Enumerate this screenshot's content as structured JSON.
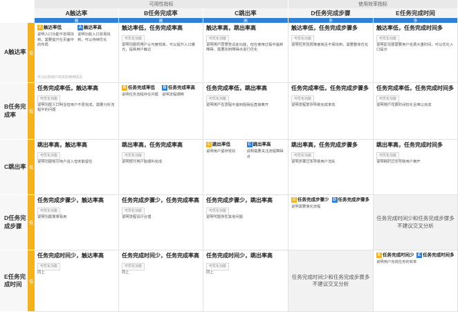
{
  "groups": {
    "usability": "可用性指标",
    "efficiency": "使用效率指标"
  },
  "priority": {
    "high": "高",
    "many": "多",
    "row_low": "低"
  },
  "columns": [
    "A触达率",
    "B任务完成率",
    "C跳出率",
    "D任务完成步骤",
    "E任务完成时间"
  ],
  "rows": [
    "A触达率",
    "B任务完成率",
    "C跳出率",
    "D任务完成步骤",
    "E任务完成时间"
  ],
  "badge_option": "可优化功能",
  "cells": {
    "aa_title1": "触达率低",
    "aa_desc1": "说明入口功能不容易找到，需要提升在页面中的布局",
    "aa_title2": "触达率高",
    "aa_desc2": "说明功能入口容易找到，可以持续优化",
    "aa_note": "可以比较用户的实际使用情况",
    "ab_title": "触达率低，任务完成率高",
    "ab_desc": "说明功能的用户认可度较高，可以提升入口曝光，提高用户触达",
    "ac_title": "触达率高，跳出率高",
    "ac_desc": "说明用户愿意尝试此功能，但在使用过程中遇到障碍，需要找到障碍点进行优化",
    "ad_title": "触达率低，任务完成步骤多",
    "ad_desc": "说明任务完成难度高且不易找到，需要整体优化",
    "ae_title": "触达率低，任务完成时间多",
    "ae_desc": "说明此功能需要用户花费大量时间，可以优化入口提示"
  },
  "row_b": {
    "ba_title": "任务完成率低，触达率高",
    "ba_desc": "说明功能入口明显但用户不愿完成，需要分析流程中的问题",
    "bb_title1": "任务完成率低",
    "bb_desc1": "说明任务流程存在问题",
    "bb_title2": "任务完成率高",
    "bb_desc2": "说明流程顺畅",
    "bc_title": "任务完成率低，跳出率高",
    "bc_desc": "说明用户在流程中遇到阻碍后直接离开",
    "bd_title": "任务完成率低，任务完成步骤多",
    "bd_desc": "说明流程复杂导致完成率低",
    "be_title": "任务完成率低，任务完成时间多",
    "be_desc": "说明用户花费时间较长且难以完成"
  },
  "row_c": {
    "ca_title": "跳出率高，触达率高",
    "ca_desc": "说明功能吸引用户进入但未能留住",
    "cb_title": "跳出率高，任务完成率高",
    "cb_desc": "说明部分用户能顺利完成",
    "cc_title1": "跳出率低",
    "cc_desc1": "说明用户留存较好",
    "cc_title2": "跳出率高",
    "cc_desc2": "说明需要关注流程障碍点",
    "cd_title": "跳出率高，任务完成步骤多",
    "cd_desc": "说明步骤过多导致用户流失",
    "ce_title": "跳出率高，任务完成时间多",
    "ce_desc": "说明耗时过长导致用户离开"
  },
  "row_d": {
    "da_title": "任务完成步骤少，触达率高",
    "da_desc": "说明功能简单易用",
    "db_title": "任务完成步骤少，任务完成率高",
    "db_desc": "说明流程设计合理",
    "dc_title": "任务完成步骤少，跳出率高",
    "dc_desc": "说明可能存在其他问题",
    "dd_title1": "任务完成步骤少",
    "dd_title2": "任务完成步骤多",
    "dd_desc": "说明需要简化流程",
    "de_text": "任务完成时间少和任务完成步骤多不建议交叉分析"
  },
  "row_e": {
    "ea_title": "任务完成时间少，触达率高",
    "ea_desc": "同上",
    "eb_title": "任务完成时间少，任务完成率高",
    "eb_desc": "同上",
    "ec_title": "任务完成时间少，跳出率高",
    "ec_desc": "同上",
    "ed_text": "任务完成时间少和任务完成步骤多不建议交叉分析",
    "ee_title1": "任务完成时间少",
    "ee_title2": "任务完成时间多",
    "ee_desc": "说明用户完成任务的效率"
  }
}
